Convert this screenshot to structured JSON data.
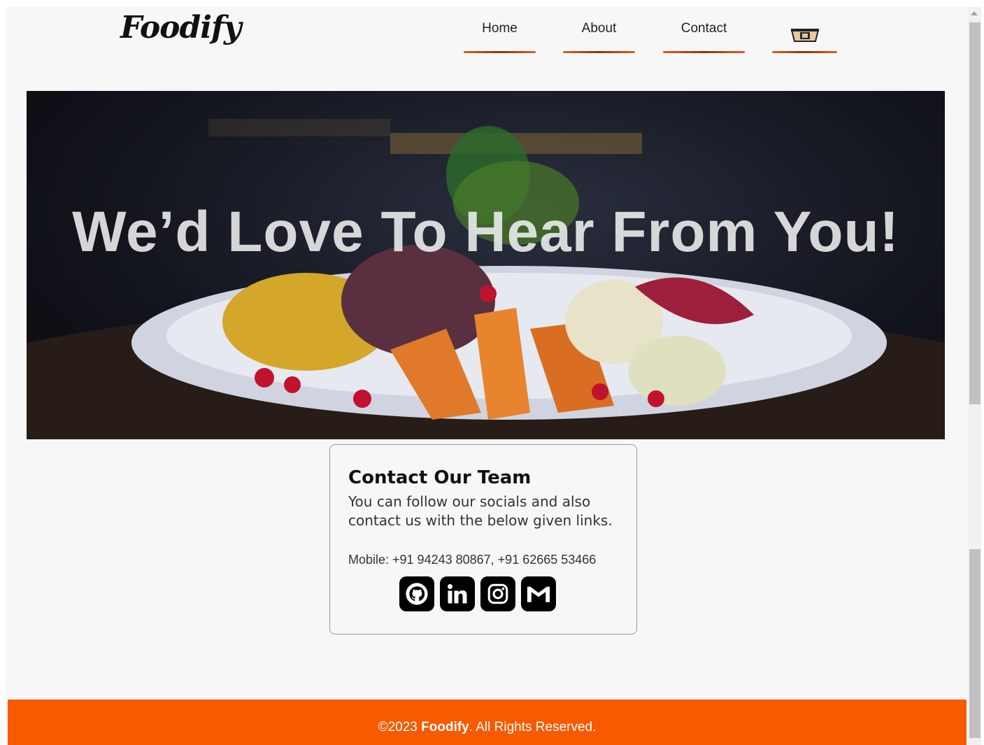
{
  "brand": {
    "logo": "Foodify"
  },
  "nav": {
    "items": [
      {
        "label": "Home"
      },
      {
        "label": "About"
      },
      {
        "label": "Contact"
      }
    ],
    "cart_icon": "takeout-box-icon"
  },
  "hero": {
    "title": "We’d Love To Hear From You!"
  },
  "contact": {
    "title": "Contact Our Team",
    "description": "You can follow our socials and also contact us with the below given links.",
    "mobile": "Mobile: +91 94243 80867, +91 62665 53466",
    "socials": [
      "github-icon",
      "linkedin-icon",
      "instagram-icon",
      "gmail-icon"
    ]
  },
  "footer": {
    "prefix": "©2023 ",
    "brand": "Foodify",
    "suffix": ". All Rights Reserved."
  },
  "colors": {
    "footer_bg": "#f75a00",
    "nav_underline": "#b24a18",
    "page_bg": "#f7f7f7"
  }
}
